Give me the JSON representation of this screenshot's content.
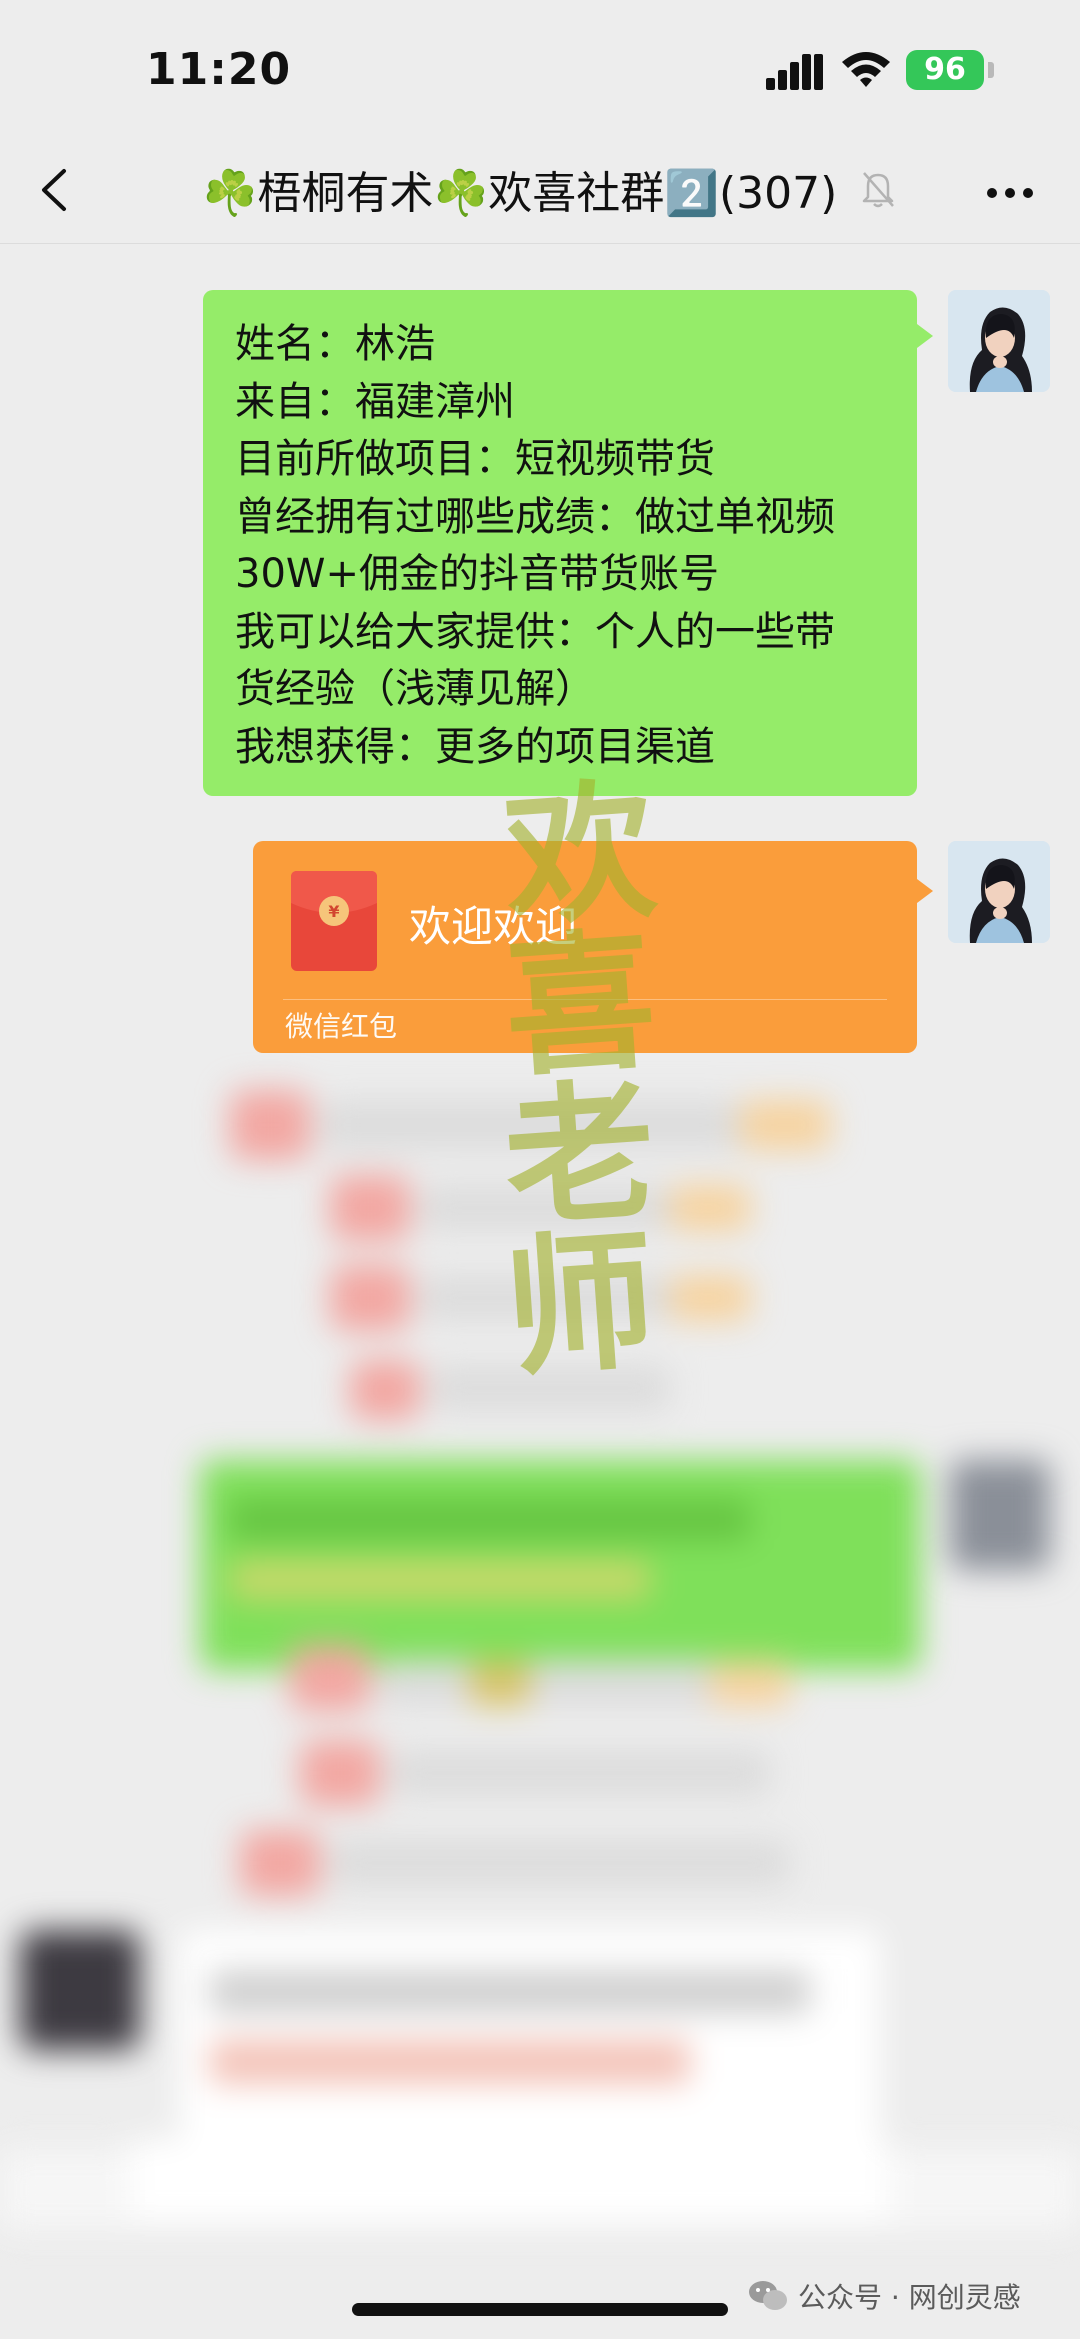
{
  "status_bar": {
    "time": "11:20",
    "battery_level": "96",
    "icons": [
      "cellular-signal-icon",
      "wifi-icon",
      "battery-charging-icon"
    ]
  },
  "nav_bar": {
    "title": "☘️梧桐有术☘️欢喜社群2️⃣(307)",
    "muted": true,
    "icons": [
      "back-chevron-icon",
      "mute-bell-icon",
      "more-dots-icon"
    ]
  },
  "messages": [
    {
      "type": "text",
      "lines": [
        "姓名：林浩",
        "来自：福建漳州",
        "目前所做项目：短视频带货",
        "曾经拥有过哪些成绩：做过单视频",
        "30W+佣金的抖音带货账号",
        "我可以给大家提供：个人的一些带",
        "货经验（浅薄见解）",
        "我想获得：更多的项目渠道"
      ]
    },
    {
      "type": "red_packet",
      "greeting": "欢迎欢迎",
      "label": "微信红包"
    }
  ],
  "watermark": [
    "欢",
    "喜",
    "老",
    "师"
  ],
  "footer": {
    "text": "公众号 · 网创灵感"
  },
  "colors": {
    "chat_background": "#ededed",
    "sent_bubble": "#95ec69",
    "red_packet": "#fa9d3b",
    "battery": "#34c759",
    "watermark": "#a3b12d"
  }
}
